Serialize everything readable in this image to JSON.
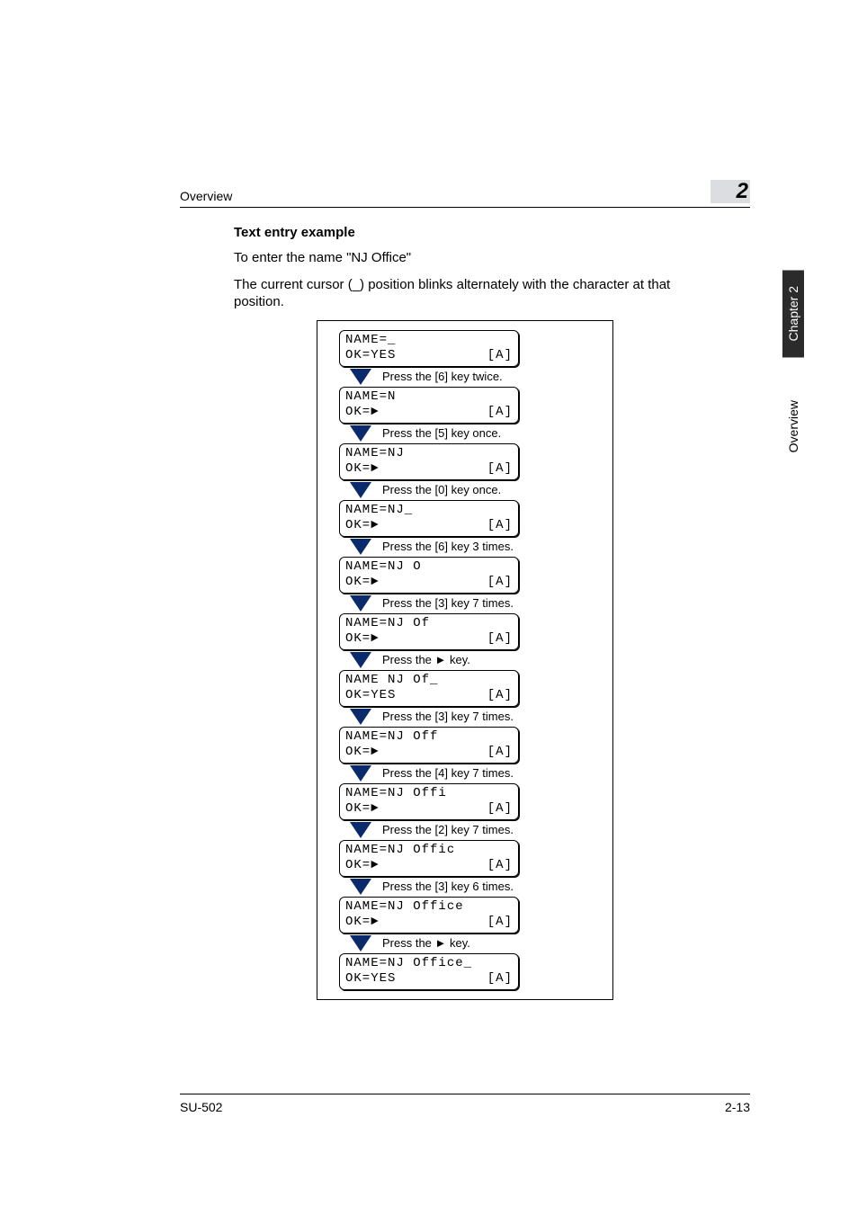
{
  "header": {
    "section_name": "Overview",
    "chapter_number": "2"
  },
  "content": {
    "heading": "Text entry example",
    "intro": "To enter the name \"NJ Office\"",
    "cursor_note": "The current cursor (_) position blinks alternately with the character at that position.",
    "right_arrow_glyph": "►"
  },
  "steps": [
    {
      "line1_left": "NAME=_",
      "ok": "OK=YES",
      "mode": "[A]",
      "action_parts": [
        "Press the [6] key twice."
      ]
    },
    {
      "line1_left": "NAME=N",
      "ok": "OK=►",
      "mode": "[A]",
      "action_parts": [
        "Press the [5] key once."
      ]
    },
    {
      "line1_left": "NAME=NJ",
      "ok": "OK=►",
      "mode": "[A]",
      "action_parts": [
        "Press the [0] key once."
      ]
    },
    {
      "line1_left": "NAME=NJ_",
      "ok": "OK=►",
      "mode": "[A]",
      "action_parts": [
        "Press the [6] key 3 times."
      ]
    },
    {
      "line1_left": "NAME=NJ O",
      "ok": "OK=►",
      "mode": "[A]",
      "action_parts": [
        "Press the [3] key 7 times."
      ]
    },
    {
      "line1_left": "NAME=NJ Of",
      "ok": "OK=►",
      "mode": "[A]",
      "action_parts": [
        "Press the ",
        "►",
        " key."
      ]
    },
    {
      "line1_left": "NAME NJ Of_",
      "ok": "OK=YES",
      "mode": "[A]",
      "action_parts": [
        "Press the [3] key 7 times."
      ]
    },
    {
      "line1_left": "NAME=NJ Off",
      "ok": "OK=►",
      "mode": "[A]",
      "action_parts": [
        "Press the [4] key 7 times."
      ]
    },
    {
      "line1_left": "NAME=NJ Offi",
      "ok": "OK=►",
      "mode": "[A]",
      "action_parts": [
        "Press the [2] key 7 times."
      ]
    },
    {
      "line1_left": "NAME=NJ Offic",
      "ok": "OK=►",
      "mode": "[A]",
      "action_parts": [
        "Press the [3] key 6 times."
      ]
    },
    {
      "line1_left": "NAME=NJ Office",
      "ok": "OK=►",
      "mode": "[A]",
      "action_parts": [
        "Press the ",
        "►",
        " key."
      ]
    },
    {
      "line1_left": "NAME=NJ Office_",
      "ok": "OK=YES",
      "mode": "[A]"
    }
  ],
  "footer": {
    "model": "SU-502",
    "page": "2-13"
  },
  "side_tabs": {
    "chapter": "Chapter 2",
    "section": "Overview"
  }
}
